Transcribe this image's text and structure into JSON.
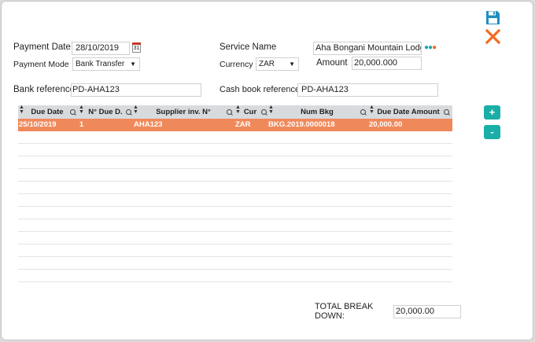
{
  "header": {
    "save_icon": "floppy-disk-icon",
    "close_icon": "close-icon"
  },
  "form": {
    "payment_date_label": "Payment Date",
    "payment_date": "28/10/2019",
    "calendar_icon_text": "31",
    "service_name_label": "Service Name",
    "service_name": "Aha Bongani Mountain Lodge",
    "payment_mode_label": "Payment Mode",
    "payment_mode": "Bank Transfer",
    "currency_label": "Currency",
    "currency": "ZAR",
    "amount_label": "Amount",
    "amount": "20,000.000",
    "bank_reference_label": "Bank reference:",
    "bank_reference": "PD-AHA123",
    "cash_book_reference_label": "Cash book reference:",
    "cash_book_reference": "PD-AHA123"
  },
  "grid": {
    "columns": [
      "Due Date",
      "N° Due D.",
      "Supplier inv. N°",
      "Cur",
      "Num Bkg",
      "Due Date Amount"
    ],
    "rows": [
      {
        "due_date": "25/10/2019",
        "due_no": "1",
        "supplier_inv": "AHA123",
        "cur": "ZAR",
        "num_bkg": "BKG.2019.0000018",
        "amount": "20,000.00"
      }
    ],
    "add_label": "+",
    "remove_label": "-"
  },
  "footer": {
    "total_label_line1": "TOTAL BREAK",
    "total_label_line2": "DOWN:",
    "total_value": "20,000.00"
  },
  "colors": {
    "accent": "#1aaea8",
    "selected_row": "#f0895a",
    "close": "#f26b22",
    "save": "#1f8fc0"
  }
}
